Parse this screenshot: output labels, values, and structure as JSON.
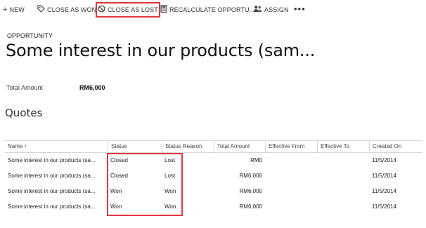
{
  "toolbar": {
    "new": {
      "label": "NEW",
      "icon": "plus-icon"
    },
    "close_as_won": {
      "label": "CLOSE AS WON",
      "icon": "tag-icon"
    },
    "close_as_lost": {
      "label": "CLOSE AS LOST",
      "icon": "cancel-circle-icon"
    },
    "recalculate": {
      "label": "RECALCULATE OPPORTU...",
      "icon": "calculator-icon"
    },
    "assign": {
      "label": "ASSIGN",
      "icon": "people-icon"
    },
    "more": "•••"
  },
  "header": {
    "entity": "OPPORTUNITY",
    "title": "Some interest in our products (sam..."
  },
  "fields": {
    "total_amount_label": "Total Amount",
    "total_amount_value": "RM6,000"
  },
  "quotes": {
    "title": "Quotes",
    "columns": [
      "Name",
      "Status",
      "Status Reason",
      "Total Amount",
      "Effective From",
      "Effective To",
      "Created On"
    ],
    "sort_icon": "↑",
    "rows": [
      [
        "Some interest in our products (sa...",
        "Closed",
        "Lost",
        "RM0",
        "",
        "",
        "11/5/2014"
      ],
      [
        "Some interest in our products (sa...",
        "Closed",
        "Lost",
        "RM6,000",
        "",
        "",
        "11/5/2014"
      ],
      [
        "Some interest in our products (sa...",
        "Won",
        "Won",
        "RM6,000",
        "",
        "",
        "11/5/2014"
      ],
      [
        "Some interest in our products (sa...",
        "Won",
        "Won",
        "RM6,000",
        "",
        "",
        "11/5/2014"
      ]
    ]
  },
  "colors": {
    "highlight": "#e0383e",
    "grid_border": "#d6d6d6"
  }
}
